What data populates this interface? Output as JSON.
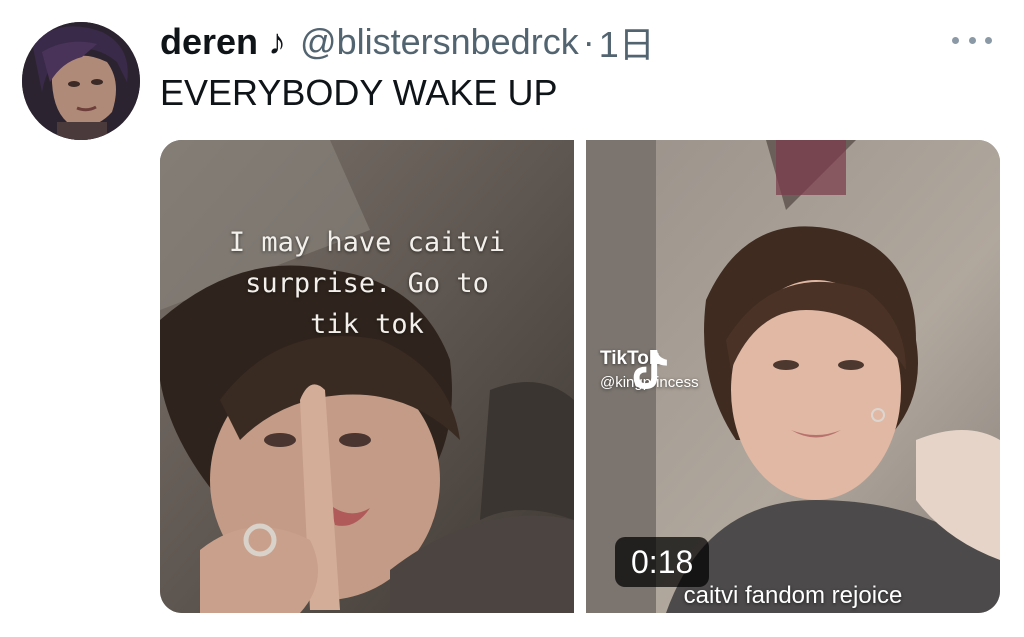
{
  "tweet": {
    "display_name": "deren ♪",
    "handle": "@blistersnbedrck",
    "separator": "·",
    "time": "1日",
    "text": "EVERYBODY WAKE UP"
  },
  "media": {
    "left_photo": {
      "overlay_lines": [
        "I may have caitvi",
        "surprise. Go to",
        "tik tok"
      ]
    },
    "right_video": {
      "watermark_brand": "TikTok",
      "watermark_user": "@kingprincess",
      "duration": "0:18",
      "caption": "caitvi fandom rejoice"
    }
  },
  "icons": {
    "more": "more-horizontal-icon",
    "tiktok": "tiktok-note-icon"
  },
  "colors": {
    "text_primary": "#0f1419",
    "text_secondary": "#536471",
    "more_dots": "#8b98a5"
  }
}
